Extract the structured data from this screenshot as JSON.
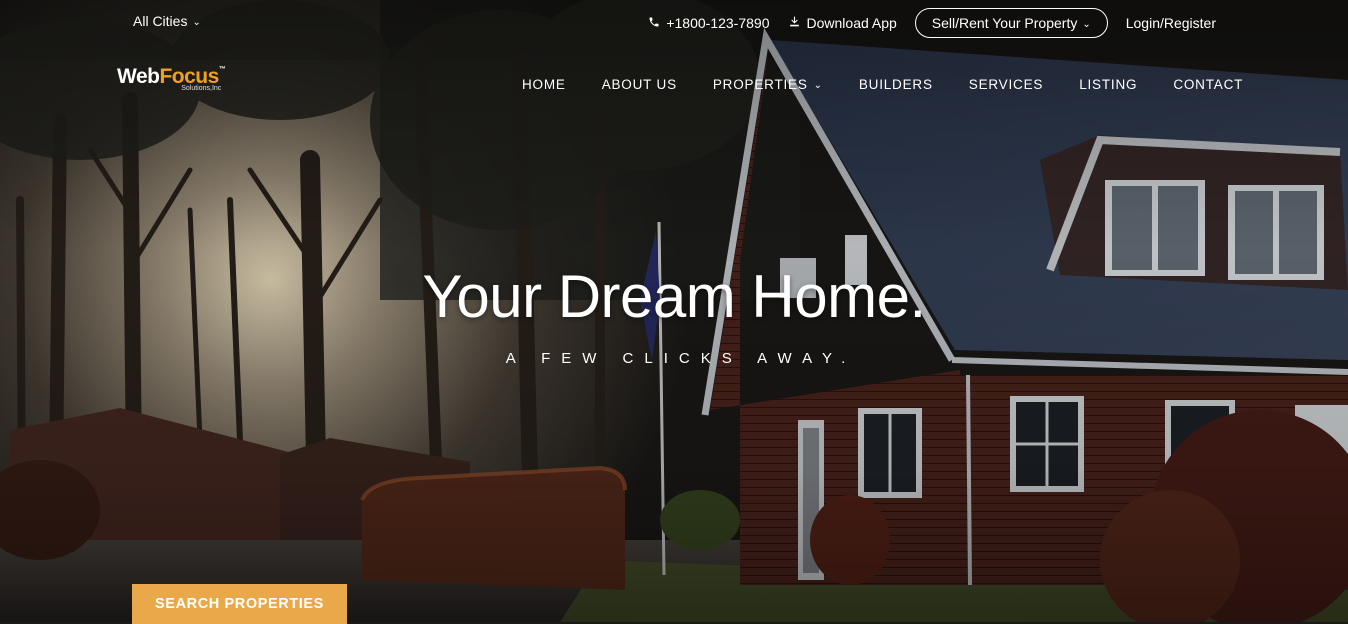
{
  "topbar": {
    "city_label": "All Cities",
    "phone": "+1800-123-7890",
    "download": "Download App",
    "sell_rent": "Sell/Rent Your Property",
    "login": "Login/Register"
  },
  "logo": {
    "part1": "Web",
    "part2": "Focus",
    "tm": "™",
    "sub": "Solutions,Inc"
  },
  "nav": {
    "home": "HOME",
    "about": "ABOUT US",
    "properties": "PROPERTIES",
    "builders": "BUILDERS",
    "services": "SERVICES",
    "listing": "LISTING",
    "contact": "CONTACT"
  },
  "hero": {
    "title": "Your Dream Home.",
    "subtitle": "A FEW CLICKS AWAY."
  },
  "cta": {
    "label": "SEARCH PROPERTIES"
  },
  "colors": {
    "accent": "#e9a94a",
    "logo_accent": "#f0a020"
  },
  "icons": {
    "phone": "phone-icon",
    "download": "download-icon",
    "chevron": "chevron-down-icon"
  }
}
